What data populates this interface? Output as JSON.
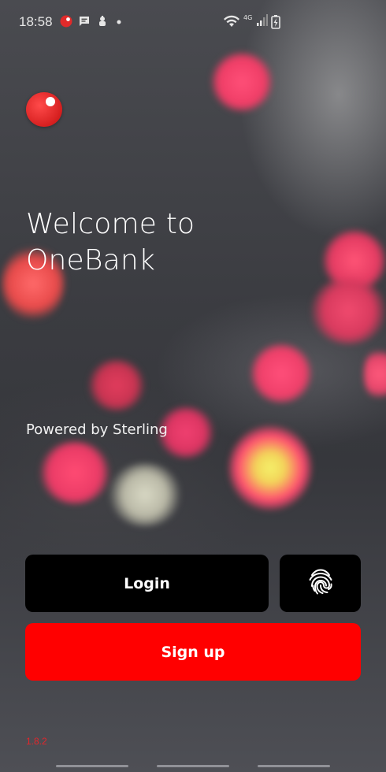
{
  "status_bar": {
    "time": "18:58",
    "icons": [
      "app-notification-icon",
      "chat-icon",
      "usb-debug-icon",
      "dot-icon",
      "wifi-icon",
      "4g-signal-icon",
      "battery-charging-icon"
    ],
    "network_label": "4G"
  },
  "app": {
    "logo": "onebank-logo",
    "welcome_line1": "Welcome to",
    "welcome_line2": "OneBank",
    "powered_by": "Powered by Sterling",
    "version": "1.8.2"
  },
  "buttons": {
    "login_label": "Login",
    "fingerprint_icon": "fingerprint-icon",
    "signup_label": "Sign up"
  },
  "colors": {
    "accent_red": "#ff0000",
    "logo_red": "#d61f1f",
    "button_dark": "#000000",
    "version_text": "#e3262b"
  },
  "navigation": [
    "gesture-bar-left",
    "gesture-bar-center",
    "gesture-bar-right"
  ]
}
